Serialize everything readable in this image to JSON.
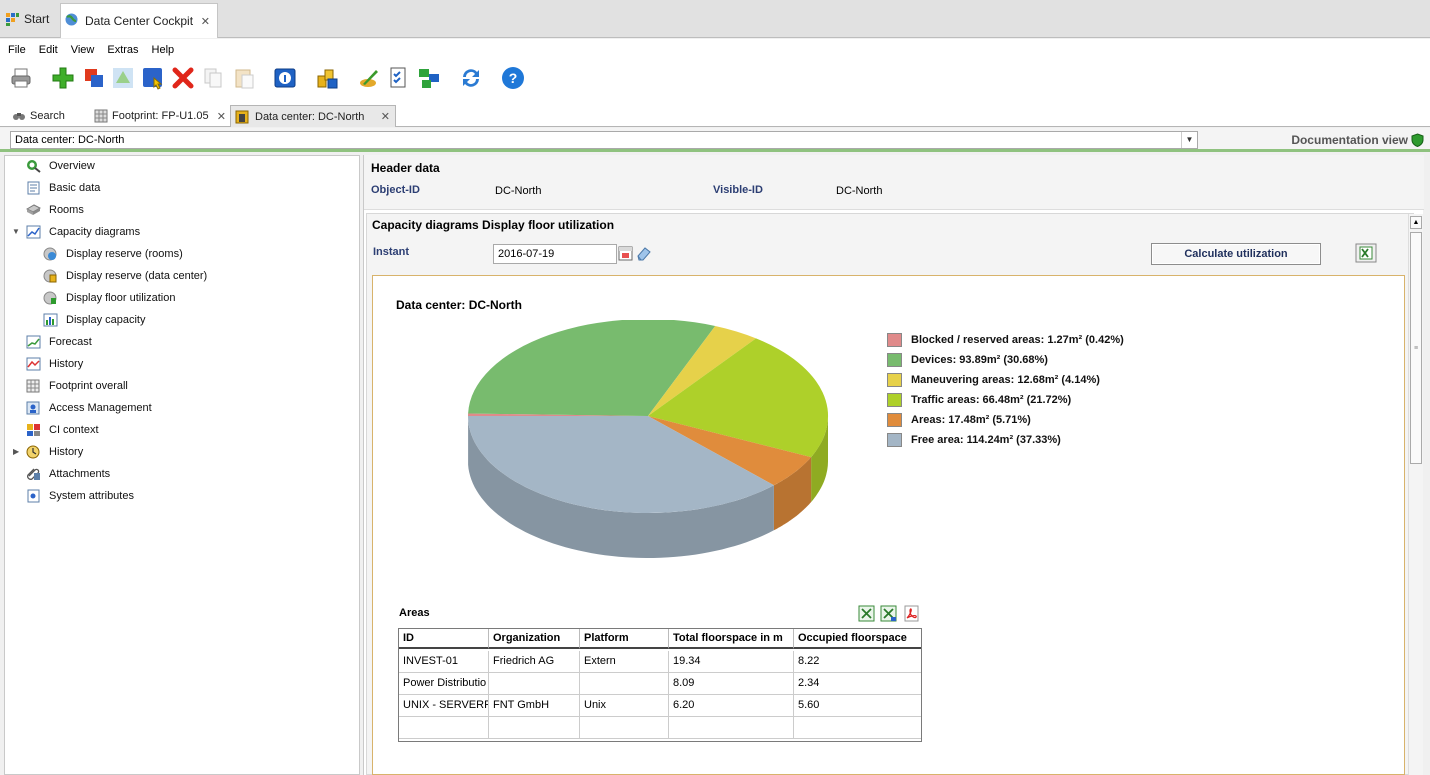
{
  "app_tabs": {
    "start": "Start",
    "cockpit": "Data Center Cockpit"
  },
  "menu": [
    "File",
    "Edit",
    "View",
    "Extras",
    "Help"
  ],
  "toolbar": {
    "icons": [
      "print-icon",
      "add-icon",
      "copy-objects-icon",
      "triangle-icon",
      "navigate-icon",
      "delete-icon",
      "copy-icon",
      "paste-icon",
      "info-icon",
      "objects-icon",
      "edit-icon",
      "checklist-icon",
      "network-icon",
      "refresh-icon",
      "help-icon"
    ],
    "help_glyph": "?"
  },
  "doc_tabs": {
    "search": "Search",
    "footprint": "Footprint: FP-U1.05",
    "datacenter": "Data center: DC-North"
  },
  "selector": {
    "value": "Data center: DC-North",
    "documentation_view": "Documentation view"
  },
  "tree": {
    "items": [
      {
        "label": "Overview"
      },
      {
        "label": "Basic data"
      },
      {
        "label": "Rooms"
      },
      {
        "label": "Capacity diagrams"
      },
      {
        "label": "Display reserve (rooms)"
      },
      {
        "label": "Display reserve (data center)"
      },
      {
        "label": "Display floor utilization"
      },
      {
        "label": "Display capacity"
      },
      {
        "label": "Forecast"
      },
      {
        "label": "History"
      },
      {
        "label": "Footprint overall"
      },
      {
        "label": "Access Management"
      },
      {
        "label": "CI context"
      },
      {
        "label": "History"
      },
      {
        "label": "Attachments"
      },
      {
        "label": "System attributes"
      }
    ]
  },
  "header": {
    "title": "Header data",
    "object_id_label": "Object-ID",
    "object_id_value": "DC-North",
    "visible_id_label": "Visible-ID",
    "visible_id_value": "DC-North"
  },
  "capacity": {
    "title": "Capacity diagrams Display floor utilization",
    "instant_label": "Instant",
    "instant_value": "2016-07-19",
    "calculate_button": "Calculate utilization",
    "areas_label": "Areas"
  },
  "chart_data": {
    "type": "pie",
    "title": "Data center: DC-North",
    "slices": [
      {
        "label": "Blocked / reserved areas: 1.27m² (0.42%)",
        "value": 1.27,
        "color": "#e08a8a"
      },
      {
        "label": "Devices: 93.89m² (30.68%)",
        "value": 93.89,
        "color": "#78bb6e"
      },
      {
        "label": "Maneuvering areas: 12.68m² (4.14%)",
        "value": 12.68,
        "color": "#e6d14a"
      },
      {
        "label": "Traffic areas: 66.48m² (21.72%)",
        "value": 66.48,
        "color": "#aed02a"
      },
      {
        "label": "Areas: 17.48m² (5.71%)",
        "value": 17.48,
        "color": "#e08c3c"
      },
      {
        "label": "Free area: 114.24m² (37.33%)",
        "value": 114.24,
        "color": "#a4b6c6"
      }
    ]
  },
  "table": {
    "columns": [
      "ID",
      "Organization",
      "Platform",
      "Total floorspace in m",
      "Occupied floorspace"
    ],
    "rows": [
      [
        "INVEST-01",
        "Friedrich AG",
        "Extern",
        "19.34",
        "8.22"
      ],
      [
        "Power Distributio",
        "",
        "",
        "8.09",
        "2.34"
      ],
      [
        "UNIX - SERVERFA",
        "FNT GmbH",
        "Unix",
        "6.20",
        "5.60"
      ],
      [
        "",
        "",
        "",
        "",
        ""
      ]
    ]
  }
}
